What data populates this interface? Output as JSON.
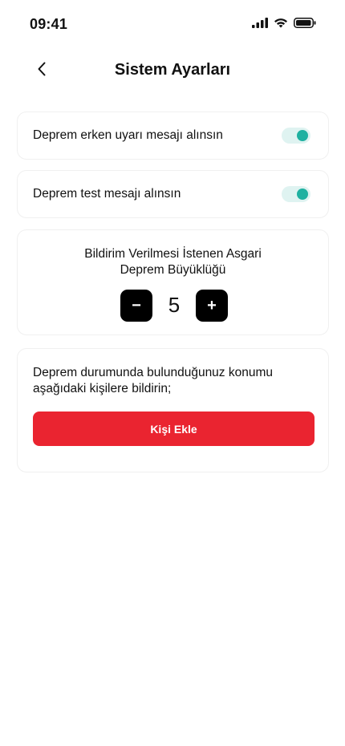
{
  "status_bar": {
    "time": "09:41",
    "icons": [
      "cellular-signal-icon",
      "wifi-icon",
      "battery-icon"
    ]
  },
  "header": {
    "back_icon": "chevron-left-icon",
    "title": "Sistem Ayarları"
  },
  "settings": {
    "early_warning": {
      "label": "Deprem erken uyarı mesajı alınsın",
      "enabled": true
    },
    "test_message": {
      "label": "Deprem test mesajı alınsın",
      "enabled": true
    }
  },
  "magnitude": {
    "title_line1": "Bildirim Verilmesi İstenen Asgari",
    "title_line2": "Deprem Büyüklüğü",
    "decrement_label": "−",
    "increment_label": "+",
    "value": "5"
  },
  "contacts": {
    "description": "Deprem durumunda bulunduğunuz konumu aşağıdaki kişilere bildirin;",
    "add_button_label": "Kişi Ekle"
  },
  "colors": {
    "accent_teal": "#1fb1a1",
    "toggle_track": "#dff3f1",
    "primary_red": "#ea2430",
    "stepper_black": "#000000"
  }
}
